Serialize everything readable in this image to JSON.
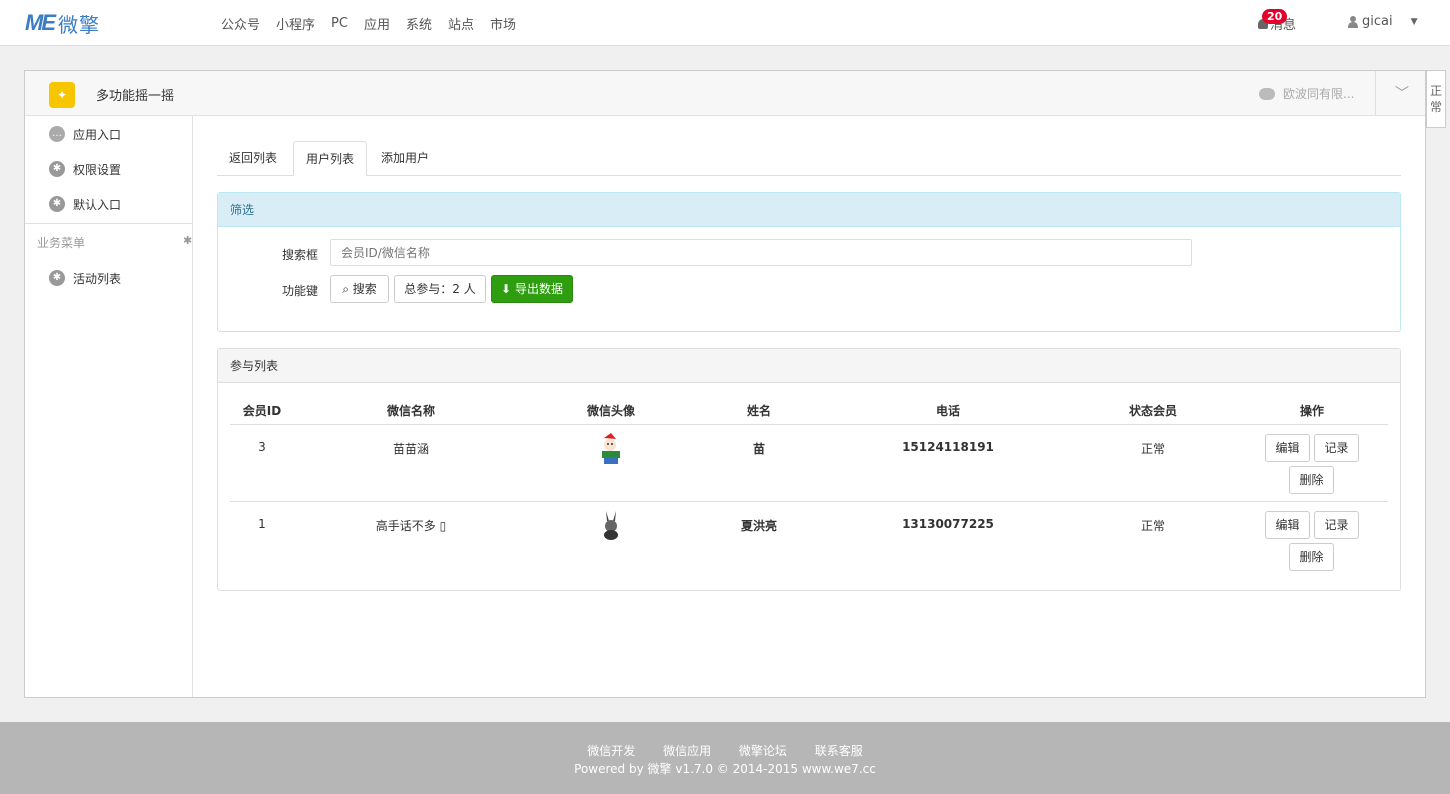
{
  "brand": {
    "logo_mark": "ME",
    "logo_text": "微擎"
  },
  "nav": [
    "公众号",
    "小程序",
    "PC",
    "应用",
    "系统",
    "站点",
    "市场"
  ],
  "messages": {
    "label": "消息",
    "count": "20"
  },
  "user": {
    "name": "gicai"
  },
  "app": {
    "title": "多功能摇一摇",
    "account": "欧波同有限..."
  },
  "side_tab": "正常",
  "sidebar": {
    "items": [
      {
        "label": "应用入口",
        "icon": "chat-icon"
      },
      {
        "label": "权限设置",
        "icon": "gear-icon"
      },
      {
        "label": "默认入口",
        "icon": "gear-icon"
      }
    ],
    "group": "业务菜单",
    "group_items": [
      {
        "label": "活动列表",
        "icon": "gear-icon"
      }
    ]
  },
  "tabs": [
    "返回列表",
    "用户列表",
    "添加用户"
  ],
  "filter": {
    "title": "筛选",
    "search_label": "搜索框",
    "search_placeholder": "会员ID/微信名称",
    "func_label": "功能键",
    "search_btn": "搜索",
    "total": "总参与：2 人",
    "export_btn": "导出数据"
  },
  "list": {
    "title": "参与列表",
    "headers": [
      "会员ID",
      "微信名称",
      "微信头像",
      "姓名",
      "电话",
      "状态会员",
      "操作"
    ],
    "rows": [
      {
        "id": "3",
        "nickname": "苗苗涵",
        "name": "苗",
        "phone": "15124118191",
        "status": "正常"
      },
      {
        "id": "1",
        "nickname": "高手话不多 ▯",
        "name": "夏洪亮",
        "phone": "13130077225",
        "status": "正常"
      }
    ],
    "actions": {
      "edit": "编辑",
      "record": "记录",
      "delete": "删除"
    }
  },
  "footer": {
    "links": [
      "微信开发",
      "微信应用",
      "微擎论坛",
      "联系客服"
    ],
    "copyright": "Powered by 微擎 v1.7.0 © 2014-2015 www.we7.cc"
  }
}
